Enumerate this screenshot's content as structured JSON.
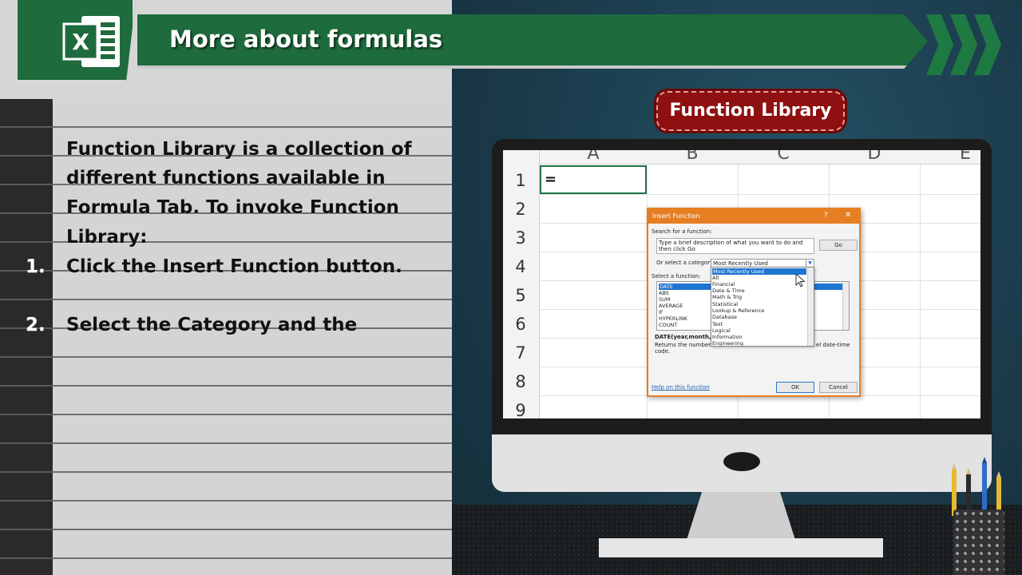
{
  "header": {
    "title": "More about formulas",
    "app_logo_letter": "X"
  },
  "badge": {
    "label": "Function Library"
  },
  "notes": {
    "lines": [
      "Function Library is a collection of",
      "different functions available in",
      "Formula Tab. To invoke Function",
      "Library:"
    ],
    "steps": [
      {
        "number": "1.",
        "text": "Click the Insert Function button."
      },
      {
        "number": "2.",
        "text": "Select the Category and the"
      }
    ]
  },
  "spreadsheet": {
    "columns": [
      "A",
      "B",
      "C",
      "D",
      "E"
    ],
    "rows": [
      "1",
      "2",
      "3",
      "4",
      "5",
      "6",
      "7",
      "8",
      "9"
    ],
    "active_cell_value": "="
  },
  "dialog": {
    "title": "Insert Function",
    "help_label": "?",
    "close_label": "✕",
    "search_label": "Search for a function:",
    "search_value": "Type a brief description of what you want to do and then click Go",
    "go_label": "Go",
    "category_label": "Or select a category:",
    "category_value": "Most Recently Used",
    "function_label": "Select a function:",
    "category_options": [
      "Most Recently Used",
      "All",
      "Financial",
      "Date & Time",
      "Math & Trig",
      "Statistical",
      "Lookup & Reference",
      "Database",
      "Text",
      "Logical",
      "Information",
      "Engineering"
    ],
    "functions": [
      "DATE",
      "ABS",
      "SUM",
      "AVERAGE",
      "IF",
      "HYPERLINK",
      "COUNT"
    ],
    "syntax": "DATE(year,month,da",
    "description_start": "Returns the number",
    "description_end": "el date-time",
    "description_tail": "code.",
    "help_link": "Help on this function",
    "ok_label": "OK",
    "cancel_label": "Cancel"
  },
  "colors": {
    "excel_green": "#1e6b3d",
    "badge_red": "#8e1010",
    "dialog_orange": "#e67e22",
    "selection_blue": "#1e75d1"
  }
}
